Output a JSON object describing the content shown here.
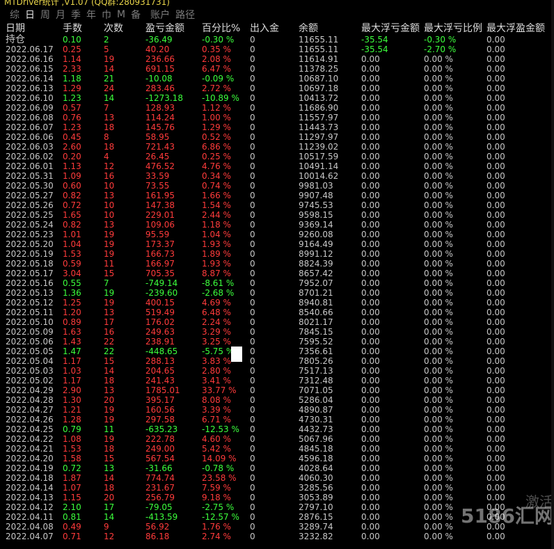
{
  "titlebar": {
    "text": "MTDriver统计 ,V1.07 (QQ群:280931731)"
  },
  "tabs": [
    "综",
    "日",
    "周",
    "月",
    "季",
    "年",
    "巾",
    "M",
    "备",
    "账户",
    "路径"
  ],
  "active_tab": 1,
  "headers": [
    "日期",
    "手数",
    "次数",
    "盈亏金额",
    "百分比%",
    "出入金",
    "余额",
    "最大浮亏金额",
    "最大浮亏比例",
    "最大浮盈金额"
  ],
  "holding_row": {
    "date": "持仓",
    "sc": "0.10",
    "cs": "2",
    "yk": "-36.49",
    "pct": "-0.30 %",
    "in": "0",
    "bal": "11655.11",
    "mfl": "-35.54",
    "mflp": "-0.30 %",
    "mfy": "0.00"
  },
  "rows": [
    [
      "2022.06.17",
      "0.25",
      "5",
      "40.20",
      "0.35 %",
      "0",
      "11655.11",
      "-35.54",
      "-2.70 %",
      "0.00"
    ],
    [
      "2022.06.16",
      "1.14",
      "19",
      "236.66",
      "2.08 %",
      "0",
      "11614.91",
      "0.00",
      "0.00 %",
      "0.00"
    ],
    [
      "2022.06.15",
      "2.33",
      "14",
      "691.15",
      "6.47 %",
      "0",
      "11378.25",
      "0.00",
      "0.00 %",
      "0.00"
    ],
    [
      "2022.06.14",
      "1.18",
      "21",
      "-10.08",
      "-0.09 %",
      "0",
      "10687.10",
      "0.00",
      "0.00 %",
      "0.00"
    ],
    [
      "2022.06.13",
      "1.29",
      "24",
      "283.46",
      "2.72 %",
      "0",
      "10697.18",
      "0.00",
      "0.00 %",
      "0.00"
    ],
    [
      "2022.06.10",
      "1.23",
      "14",
      "-1273.18",
      "-10.89 %",
      "0",
      "10413.72",
      "0.00",
      "0.00 %",
      "0.00"
    ],
    [
      "2022.06.09",
      "0.57",
      "7",
      "128.93",
      "1.12 %",
      "0",
      "11686.90",
      "0.00",
      "0.00 %",
      "0.00"
    ],
    [
      "2022.06.08",
      "0.76",
      "13",
      "114.24",
      "1.00 %",
      "0",
      "11557.97",
      "0.00",
      "0.00 %",
      "0.00"
    ],
    [
      "2022.06.07",
      "1.23",
      "18",
      "145.76",
      "1.29 %",
      "0",
      "11443.73",
      "0.00",
      "0.00 %",
      "0.00"
    ],
    [
      "2022.06.06",
      "0.45",
      "8",
      "58.95",
      "0.52 %",
      "0",
      "11297.97",
      "0.00",
      "0.00 %",
      "0.00"
    ],
    [
      "2022.06.03",
      "2.60",
      "18",
      "721.43",
      "6.86 %",
      "0",
      "11239.02",
      "0.00",
      "0.00 %",
      "0.00"
    ],
    [
      "2022.06.02",
      "0.20",
      "4",
      "26.45",
      "0.25 %",
      "0",
      "10517.59",
      "0.00",
      "0.00 %",
      "0.00"
    ],
    [
      "2022.06.01",
      "1.13",
      "12",
      "476.52",
      "4.76 %",
      "0",
      "10491.14",
      "0.00",
      "0.00 %",
      "0.00"
    ],
    [
      "2022.05.31",
      "1.09",
      "16",
      "33.59",
      "0.34 %",
      "0",
      "10014.62",
      "0.00",
      "0.00 %",
      "0.00"
    ],
    [
      "2022.05.30",
      "0.60",
      "10",
      "73.55",
      "0.74 %",
      "0",
      "9981.03",
      "0.00",
      "0.00 %",
      "0.00"
    ],
    [
      "2022.05.27",
      "0.82",
      "13",
      "161.95",
      "1.66 %",
      "0",
      "9907.48",
      "0.00",
      "0.00 %",
      "0.00"
    ],
    [
      "2022.05.26",
      "0.72",
      "10",
      "147.38",
      "1.54 %",
      "0",
      "9745.53",
      "0.00",
      "0.00 %",
      "0.00"
    ],
    [
      "2022.05.25",
      "1.65",
      "10",
      "229.01",
      "2.44 %",
      "0",
      "9598.15",
      "0.00",
      "0.00 %",
      "0.00"
    ],
    [
      "2022.05.24",
      "0.82",
      "13",
      "109.06",
      "1.18 %",
      "0",
      "9369.14",
      "0.00",
      "0.00 %",
      "0.00"
    ],
    [
      "2022.05.23",
      "1.01",
      "19",
      "95.59",
      "1.04 %",
      "0",
      "9260.08",
      "0.00",
      "0.00 %",
      "0.00"
    ],
    [
      "2022.05.20",
      "1.04",
      "19",
      "173.37",
      "1.93 %",
      "0",
      "9164.49",
      "0.00",
      "0.00 %",
      "0.00"
    ],
    [
      "2022.05.19",
      "1.53",
      "19",
      "166.73",
      "1.89 %",
      "0",
      "8991.12",
      "0.00",
      "0.00 %",
      "0.00"
    ],
    [
      "2022.05.18",
      "0.59",
      "11",
      "166.97",
      "1.93 %",
      "0",
      "8824.39",
      "0.00",
      "0.00 %",
      "0.00"
    ],
    [
      "2022.05.17",
      "3.04",
      "15",
      "705.35",
      "8.87 %",
      "0",
      "8657.42",
      "0.00",
      "0.00 %",
      "0.00"
    ],
    [
      "2022.05.16",
      "0.55",
      "7",
      "-749.14",
      "-8.61 %",
      "0",
      "7952.07",
      "0.00",
      "0.00 %",
      "0.00"
    ],
    [
      "2022.05.13",
      "1.36",
      "19",
      "-239.60",
      "-2.68 %",
      "0",
      "8701.21",
      "0.00",
      "0.00 %",
      "0.00"
    ],
    [
      "2022.05.12",
      "1.25",
      "19",
      "400.15",
      "4.69 %",
      "0",
      "8940.81",
      "0.00",
      "0.00 %",
      "0.00"
    ],
    [
      "2022.05.11",
      "1.20",
      "13",
      "519.49",
      "6.48 %",
      "0",
      "8540.66",
      "0.00",
      "0.00 %",
      "0.00"
    ],
    [
      "2022.05.10",
      "0.89",
      "17",
      "176.02",
      "2.24 %",
      "0",
      "8021.17",
      "0.00",
      "0.00 %",
      "0.00"
    ],
    [
      "2022.05.09",
      "1.63",
      "16",
      "249.63",
      "3.29 %",
      "0",
      "7845.15",
      "0.00",
      "0.00 %",
      "0.00"
    ],
    [
      "2022.05.06",
      "1.43",
      "22",
      "238.91",
      "3.25 %",
      "0",
      "7595.52",
      "0.00",
      "0.00 %",
      "0.00"
    ],
    [
      "2022.05.05",
      "1.47",
      "22",
      "-448.65",
      "-5.75 %",
      "0",
      "7356.61",
      "0.00",
      "0.00 %",
      "0.00"
    ],
    [
      "2022.05.04",
      "1.17",
      "15",
      "288.13",
      "3.83 %",
      "0",
      "7805.26",
      "0.00",
      "0.00 %",
      "0.00"
    ],
    [
      "2022.05.03",
      "1.03",
      "14",
      "204.65",
      "2.80 %",
      "0",
      "7517.13",
      "0.00",
      "0.00 %",
      "0.00"
    ],
    [
      "2022.05.02",
      "1.17",
      "18",
      "241.43",
      "3.41 %",
      "0",
      "7312.48",
      "0.00",
      "0.00 %",
      "0.00"
    ],
    [
      "2022.04.29",
      "2.90",
      "13",
      "1785.01",
      "33.77 %",
      "0",
      "7071.05",
      "0.00",
      "0.00 %",
      "0.00"
    ],
    [
      "2022.04.28",
      "1.30",
      "20",
      "395.17",
      "8.08 %",
      "0",
      "5286.04",
      "0.00",
      "0.00 %",
      "0.00"
    ],
    [
      "2022.04.27",
      "1.21",
      "19",
      "160.56",
      "3.39 %",
      "0",
      "4890.87",
      "0.00",
      "0.00 %",
      "0.00"
    ],
    [
      "2022.04.26",
      "1.28",
      "19",
      "297.58",
      "6.71 %",
      "0",
      "4730.31",
      "0.00",
      "0.00 %",
      "0.00"
    ],
    [
      "2022.04.25",
      "0.79",
      "11",
      "-635.23",
      "-12.53 %",
      "0",
      "4432.73",
      "0.00",
      "0.00 %",
      "0.00"
    ],
    [
      "2022.04.22",
      "1.08",
      "19",
      "222.78",
      "4.60 %",
      "0",
      "5067.96",
      "0.00",
      "0.00 %",
      "0.00"
    ],
    [
      "2022.04.21",
      "1.53",
      "18",
      "249.00",
      "5.42 %",
      "0",
      "4845.18",
      "0.00",
      "0.00 %",
      "0.00"
    ],
    [
      "2022.04.20",
      "1.58",
      "15",
      "567.54",
      "14.09 %",
      "0",
      "4596.18",
      "0.00",
      "0.00 %",
      "0.00"
    ],
    [
      "2022.04.19",
      "0.72",
      "13",
      "-31.66",
      "-0.78 %",
      "0",
      "4028.64",
      "0.00",
      "0.00 %",
      "0.00"
    ],
    [
      "2022.04.18",
      "1.87",
      "14",
      "774.74",
      "23.58 %",
      "0",
      "4060.30",
      "0.00",
      "0.00 %",
      "0.00"
    ],
    [
      "2022.04.14",
      "1.07",
      "18",
      "231.67",
      "7.59 %",
      "0",
      "3285.56",
      "0.00",
      "0.00 %",
      "0.00"
    ],
    [
      "2022.04.13",
      "1.15",
      "20",
      "256.79",
      "9.18 %",
      "0",
      "3053.89",
      "0.00",
      "0.00 %",
      "0.00"
    ],
    [
      "2022.04.12",
      "2.10",
      "17",
      "-79.05",
      "-2.75 %",
      "0",
      "2797.10",
      "0.00",
      "0.00 %",
      "0.00"
    ],
    [
      "2022.04.11",
      "0.81",
      "14",
      "-413.59",
      "-12.57 %",
      "0",
      "2876.15",
      "0.00",
      "0.00 %",
      "0.00"
    ],
    [
      "2022.04.08",
      "0.49",
      "9",
      "56.92",
      "1.76 %",
      "0",
      "3289.74",
      "0.00",
      "0.00 %",
      "0.00"
    ],
    [
      "2022.04.07",
      "0.71",
      "12",
      "86.18",
      "2.74 %",
      "0",
      "3232.82",
      "0.00",
      "0.00 %",
      "0.00"
    ]
  ],
  "watermark": "5186汇网",
  "watermark2": "激活"
}
